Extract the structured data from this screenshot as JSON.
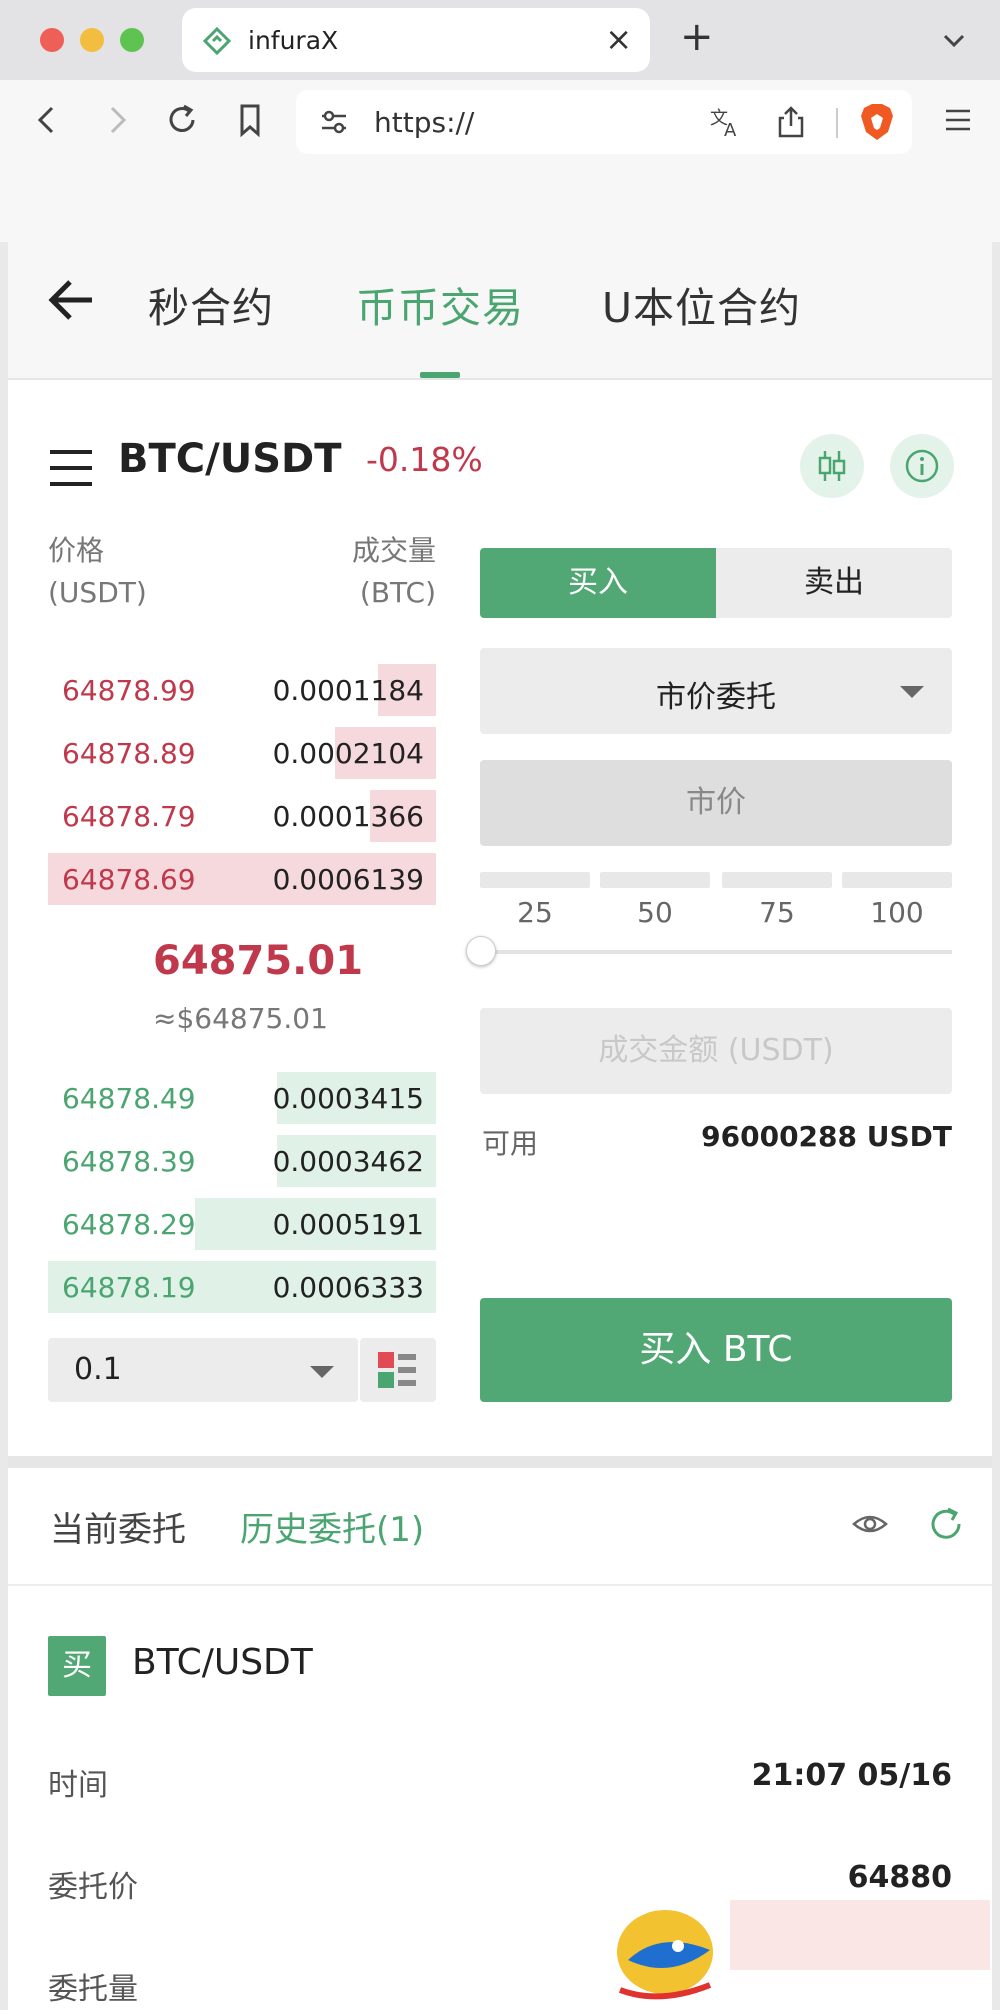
{
  "browser": {
    "tab_title": "infuraX",
    "url": "https://"
  },
  "nav": {
    "tabs": [
      "秒合约",
      "币币交易",
      "U本位合约"
    ],
    "active_index": 1
  },
  "market": {
    "pair": "BTC/USDT",
    "change": "-0.18%"
  },
  "orderbook": {
    "header_price": "价格\n(USDT)",
    "header_qty": "成交量\n(BTC)",
    "asks": [
      {
        "price": "64878.99",
        "qty": "0.0001184",
        "depth": 0.15
      },
      {
        "price": "64878.89",
        "qty": "0.0002104",
        "depth": 0.26
      },
      {
        "price": "64878.79",
        "qty": "0.0001366",
        "depth": 0.17
      },
      {
        "price": "64878.69",
        "qty": "0.0006139",
        "depth": 1.0
      }
    ],
    "last_price": "64875.01",
    "last_price_fiat": "≈$64875.01",
    "bids": [
      {
        "price": "64878.49",
        "qty": "0.0003415",
        "depth": 0.41
      },
      {
        "price": "64878.39",
        "qty": "0.0003462",
        "depth": 0.41
      },
      {
        "price": "64878.29",
        "qty": "0.0005191",
        "depth": 0.62
      },
      {
        "price": "64878.19",
        "qty": "0.0006333",
        "depth": 1.0
      }
    ],
    "step": "0.1"
  },
  "form": {
    "buy_tab": "买入",
    "sell_tab": "卖出",
    "order_type": "市价委托",
    "price_placeholder": "市价",
    "percents": [
      "25",
      "50",
      "75",
      "100"
    ],
    "slider_value": 0,
    "amount_placeholder": "成交金额 (USDT)",
    "available_label": "可用",
    "available_value": "96000288 USDT",
    "submit": "买入 BTC"
  },
  "orders": {
    "tab_current": "当前委托",
    "tab_history": "历史委托(1)",
    "entry": {
      "side": "买",
      "pair": "BTC/USDT",
      "rows": [
        {
          "label": "时间",
          "value": "21:07 05/16"
        },
        {
          "label": "委托价",
          "value": "64880"
        },
        {
          "label": "委托量",
          "value": ""
        }
      ]
    }
  },
  "colors": {
    "accent_green": "#4ba570",
    "ask_red": "#c0384b",
    "ask_depth": "#f6d9dd",
    "bid_depth": "#e0f2e7"
  },
  "icons": [
    "back-arrow-icon",
    "menu-icon",
    "candlestick-icon",
    "info-icon",
    "eye-icon",
    "refresh-icon",
    "layout-icon"
  ]
}
